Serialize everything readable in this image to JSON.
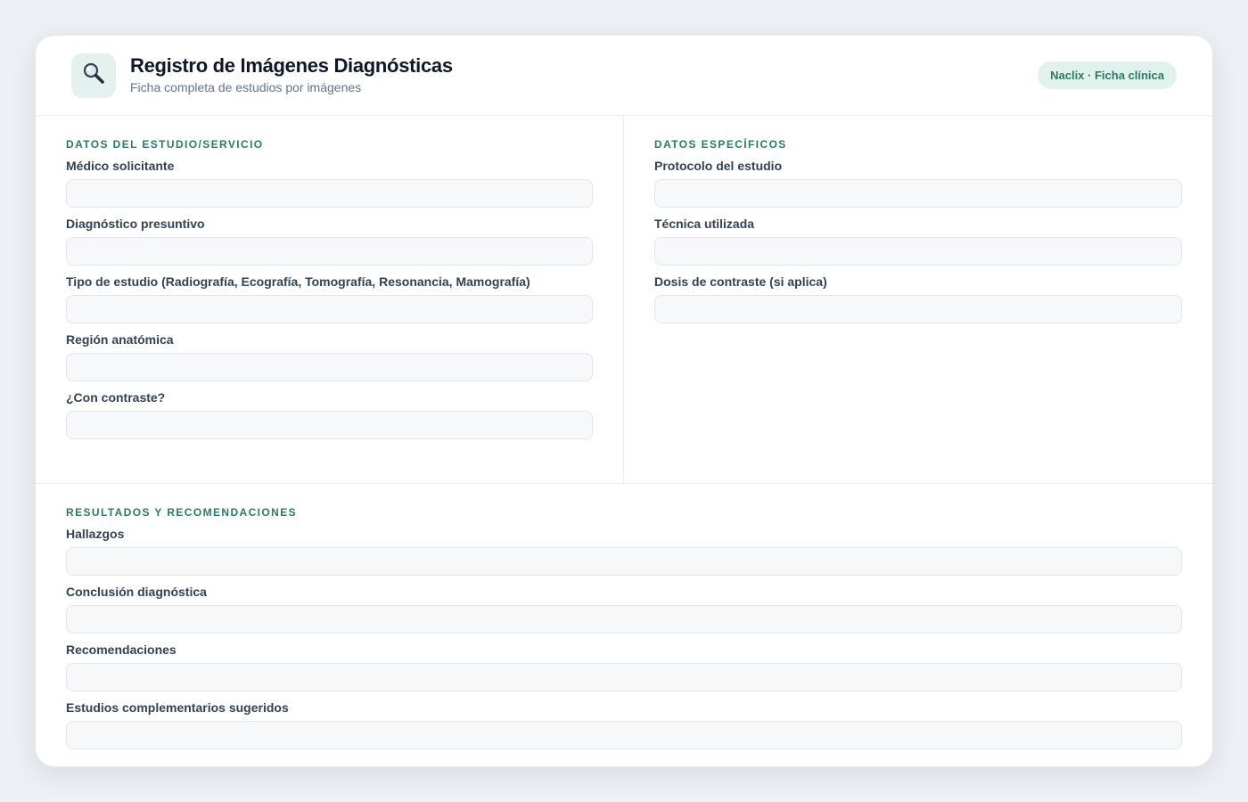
{
  "header": {
    "title": "Registro de Imágenes Diagnósticas",
    "subtitle": "Ficha completa de estudios por imágenes",
    "logo_icon": "magnifier-icon",
    "badge": "Naclix · Ficha clínica"
  },
  "study": {
    "section_title": "Datos del estudio/servicio",
    "fields": [
      {
        "label": "Médico solicitante",
        "value": "",
        "placeholder": ""
      },
      {
        "label": "Diagnóstico presuntivo",
        "value": "",
        "placeholder": ""
      },
      {
        "label": "Tipo de estudio (Radiografía, Ecografía, Tomografía, Resonancia, Mamografía)",
        "value": "",
        "placeholder": ""
      },
      {
        "label": "Región anatómica",
        "value": "",
        "placeholder": ""
      },
      {
        "label": "¿Con contraste?",
        "value": "",
        "placeholder": ""
      }
    ]
  },
  "specific": {
    "section_title": "Datos específicos",
    "fields": [
      {
        "label": "Protocolo del estudio",
        "value": "",
        "placeholder": ""
      },
      {
        "label": "Técnica utilizada",
        "value": "",
        "placeholder": ""
      },
      {
        "label": "Dosis de contraste (si aplica)",
        "value": "",
        "placeholder": ""
      }
    ]
  },
  "results": {
    "section_title": "Resultados y recomendaciones",
    "fields": [
      {
        "label": "Hallazgos",
        "value": "",
        "placeholder": ""
      },
      {
        "label": "Conclusión diagnóstica",
        "value": "",
        "placeholder": ""
      },
      {
        "label": "Recomendaciones",
        "value": "",
        "placeholder": ""
      },
      {
        "label": "Estudios complementarios sugeridos",
        "value": "",
        "placeholder": ""
      }
    ]
  },
  "colors": {
    "accent": "#2a7a68",
    "badge_bg": "#e2f1ec",
    "input_bg": "#f7f8fa",
    "page_bg": "#edf0f4"
  }
}
